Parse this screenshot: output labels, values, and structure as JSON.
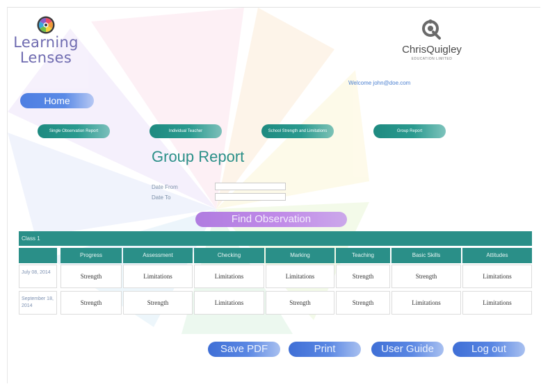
{
  "brand": {
    "app_name_line1": "Learning",
    "app_name_line2": "Lenses",
    "partner_name": "ChrisQuigley",
    "partner_subtitle": "EDUCATION LIMITED"
  },
  "header": {
    "welcome": "Welcome john@doe.com"
  },
  "nav": {
    "home": "Home",
    "single_observation": "Single Observation Report",
    "individual_teacher": "Individual Teacher",
    "school_strength": "School Strength and Limitations",
    "group_report": "Group Report"
  },
  "main": {
    "title": "Group Report",
    "date_from_label": "Date From",
    "date_to_label": "Date To",
    "date_from_value": "",
    "date_to_value": "",
    "find_button": "Find Observation"
  },
  "table": {
    "class_label": "Class 1",
    "columns": [
      "Progress",
      "Assessment",
      "Checking",
      "Marking",
      "Teaching",
      "Basic Skills",
      "Attitudes"
    ],
    "rows": [
      {
        "date": "July 08, 2014",
        "values": [
          "Strength",
          "Limitations",
          "Limitations",
          "Limitations",
          "Strength",
          "Strength",
          "Limitations"
        ]
      },
      {
        "date": "September 18, 2014",
        "values": [
          "Strength",
          "Strength",
          "Limitations",
          "Strength",
          "Strength",
          "Limitations",
          "Limitations"
        ]
      }
    ]
  },
  "footer": {
    "save_pdf": "Save PDF",
    "print": "Print",
    "user_guide": "User Guide",
    "log_out": "Log out"
  },
  "colors": {
    "teal": "#2a8f88",
    "blue_button": "#4d7ee2",
    "purple_button": "#b07ce0",
    "logo_text": "#6f6bb0"
  },
  "icons": {
    "app_logo": "camera-lens-icon",
    "partner_logo": "chris-quigley-logo-icon"
  }
}
